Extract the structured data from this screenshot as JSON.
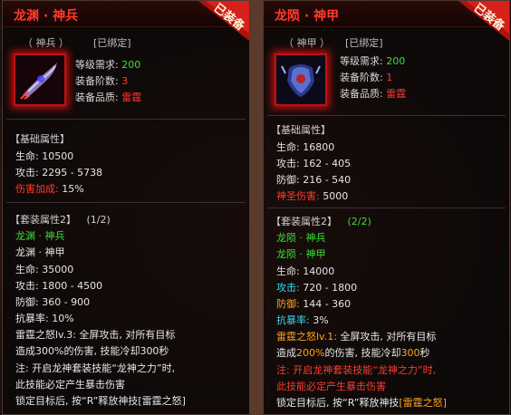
{
  "left": {
    "title": "龙渊 · 神兵",
    "badge": "已装备",
    "type_tag": "（ 神兵 ）",
    "bound_tag": "[已绑定]",
    "req_level_label": "等级需求:",
    "req_level_value": "200",
    "tier_label": "装备阶数:",
    "tier_value": "3",
    "quality_label": "装备品质:",
    "quality_value": "雷霆",
    "base_header": "【基础属性】",
    "hp_label": "生命:",
    "hp_value": "10500",
    "atk_label": "攻击:",
    "atk_value": "2295 - 5738",
    "dmg_bonus_label": "伤害加成:",
    "dmg_bonus_value": "15%",
    "set_header": "【套装属性2】",
    "set_count": "(1/2)",
    "set_item1": "龙渊 · 神兵",
    "set_item2": "龙渊 · 神甲",
    "set_hp": "生命: 35000",
    "set_atk": "攻击: 1800 - 4500",
    "set_def": "防御: 360 - 900",
    "set_crit": "抗暴率: 10%",
    "skill_line1": "雷霆之怒lv.3: 全屏攻击, 对所有目标",
    "skill_line2": "造成300%的伤害, 技能冷却300秒",
    "note_line1": "注: 开启龙神套装技能“龙神之力”时,",
    "note_line2": "此技能必定产生暴击伤害",
    "lock_line": "锁定目标后, 按“R”释放神技[雷霆之怒]"
  },
  "right": {
    "title": "龙陨 · 神甲",
    "badge": "已装备",
    "type_tag": "（ 神甲 ）",
    "bound_tag": "[已绑定]",
    "req_level_label": "等级需求:",
    "req_level_value": "200",
    "tier_label": "装备阶数:",
    "tier_value": "1",
    "quality_label": "装备品质:",
    "quality_value": "雷霆",
    "base_header": "【基础属性】",
    "hp_label": "生命:",
    "hp_value": "16800",
    "atk_label": "攻击:",
    "atk_value": "162 - 405",
    "def_label": "防御:",
    "def_value": "216 - 540",
    "holy_label": "神圣伤害:",
    "holy_value": "5000",
    "set_header": "【套装属性2】",
    "set_count": "(2/2)",
    "set_item1": "龙陨 · 神兵",
    "set_item2": "龙陨 · 神甲",
    "set_hp_label": "生命:",
    "set_hp_value": "14000",
    "set_atk_label": "攻击:",
    "set_atk_value": "720 - 1800",
    "set_def_label": "防御:",
    "set_def_value": "144 - 360",
    "set_crit_label": "抗暴率:",
    "set_crit_value": "3%",
    "skill_name": "雷霆之怒lv.1:",
    "skill_desc": "全屏攻击, 对所有目标",
    "skill_line2a": "造成",
    "skill_line2b": "200%",
    "skill_line2c": "的伤害, 技能冷却",
    "skill_line2d": "300",
    "skill_line2e": "秒",
    "note_line1": "注: 开启龙神套装技能“龙神之力”时,",
    "note_line2": "此技能必定产生暴击伤害",
    "lock_line_a": "锁定目标后, 按“R”释放神技",
    "lock_line_b": "[雷霆之怒]"
  }
}
